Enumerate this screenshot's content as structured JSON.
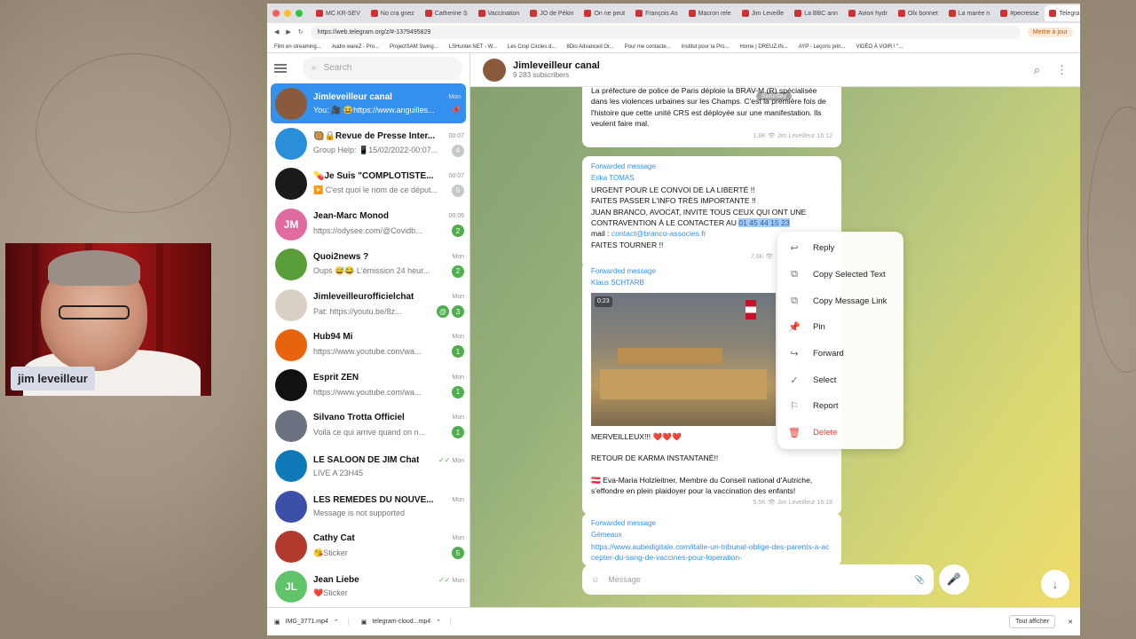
{
  "webcam": {
    "name": "jim leveilleur"
  },
  "browser": {
    "tabs": [
      "MC KR-SEV",
      "No cra gnez",
      "Catherine S",
      "Vaccination",
      "JO de Pékin",
      "On ne peut",
      "François As",
      "Macron rele",
      "Jim Leveille",
      "La BBC ann",
      "Avion hydr",
      "Olx bonnet",
      "La marée n",
      "#pecresse",
      "Telegram"
    ],
    "new_tab": "+",
    "close_tab": "×",
    "url": "https://web.telegram.org/z/#-1379495829",
    "update_button": "Mettre à jour",
    "bookmarks": [
      "Film en streaming...",
      "Audio wareZ - Pro...",
      "ProjectSAM Swing...",
      "LSHunter.NET - W...",
      "Les Crop Circles d...",
      "8Dio Advanced Or...",
      "Pour me contacte...",
      "Institut pour la Pro...",
      "Home | DREUZ.IN...",
      "AYP - Leçons prin...",
      "VIDÉO À VOIR ! \"..."
    ]
  },
  "sidebar": {
    "search_placeholder": "Search",
    "chats": [
      {
        "name": "Jimleveilleur canal",
        "time": "Mon",
        "preview": "You: 🎥 😆https://www.anguilles...",
        "avatar_color": "#8a5a3c",
        "initials": "",
        "badge": "",
        "pinned": "📌",
        "active": true
      },
      {
        "name": "🥘🔒Revue de Presse Inter...",
        "time": "00:07",
        "preview": "Group Help: 📱15/02/2022-00:07...",
        "avatar_color": "#2a8fd8",
        "initials": "",
        "badge": "4",
        "muted": true
      },
      {
        "name": "💊Je Suis \"COMPLOTISTE...",
        "time": "00:07",
        "preview": "▶️ C'est quoi le nom de ce déput...",
        "avatar_color": "#1a1a1a",
        "initials": "",
        "badge": "5",
        "muted": true
      },
      {
        "name": "Jean-Marc Monod",
        "time": "00:06",
        "preview": "https://odysee.com/@Covidb...",
        "avatar_color": "#e06ba0",
        "initials": "JM",
        "badge": "2"
      },
      {
        "name": "Quoi2news ?",
        "time": "Mon",
        "preview": "Oups 😅😂 L'émission 24 heur...",
        "avatar_color": "#5a9e3a",
        "initials": "",
        "badge": "2"
      },
      {
        "name": "Jimleveilleurofficielchat",
        "time": "Mon",
        "preview": "Pat: https://youtu.be/8z...",
        "avatar_color": "#d8d0c4",
        "initials": "",
        "badge": "3",
        "mention": "@"
      },
      {
        "name": "Hub94 Mi",
        "time": "Mon",
        "preview": "https://www.youtube.com/wa...",
        "avatar_color": "#e8640c",
        "initials": "",
        "badge": "1"
      },
      {
        "name": "Esprit ZEN",
        "time": "Mon",
        "preview": "https://www.youtube.com/wa...",
        "avatar_color": "#111111",
        "initials": "",
        "badge": "1"
      },
      {
        "name": "Silvano Trotta Officiel",
        "time": "Mon",
        "preview": "Voilà ce qui arrive quand on n...",
        "avatar_color": "#6b7280",
        "initials": "",
        "badge": "1"
      },
      {
        "name": "LE SALOON DE JIM Chat",
        "time": "Mon",
        "preview": "LIVE A 23H45",
        "avatar_color": "#0e7bb8",
        "initials": "",
        "badge": "",
        "read": "✓✓"
      },
      {
        "name": "LES REMÈDES DU NOUVE...",
        "time": "Mon",
        "preview": "Message is not supported",
        "avatar_color": "#3b4fa8",
        "initials": "",
        "badge": ""
      },
      {
        "name": "Cathy Cat",
        "time": "Mon",
        "preview": "😘Sticker",
        "avatar_color": "#b03a2e",
        "initials": "",
        "badge": "5"
      },
      {
        "name": "Jean Liebe",
        "time": "Mon",
        "preview": "❤️Sticker",
        "avatar_color": "#5fc46a",
        "initials": "JL",
        "badge": "",
        "read": "✓✓"
      }
    ]
  },
  "header": {
    "title": "Jimleveilleur canal",
    "subtitle": "9 283 subscribers"
  },
  "messages": [
    {
      "text": "La préfecture de police de Paris déploie la BRAV-M (R) spécialisée dans les violences urbaines sur les Champs. C'est la première fois de l'histoire que cette unité CRS est déployée sur une manifestation. Ils veulent faire mal.",
      "views": "1,8K",
      "author": "Jim Leveilleur",
      "time": "16:12",
      "date_chip": "Saturday"
    },
    {
      "fwd": "Forwarded message",
      "from": "Erika TOMAS",
      "lines": [
        "URGENT POUR LE CONVOI DE LA LIBERTÉ !!",
        "FAITES PASSER L'INFO TRÈS IMPORTANTE !!",
        "JUAN BRANCO, AVOCAT, INVITE TOUS CEUX QUI ONT UNE CONTRAVENTION À LE CONTACTER AU"
      ],
      "phone": "01 45 44 15 23",
      "mail_label": "mail : ",
      "mail": "contact@branco-associes.fr",
      "last": "FAITES TOURNER !!",
      "views": "7,6K"
    },
    {
      "fwd": "Forwarded message",
      "from": "Klaus SCHTARB",
      "video_time": "0:23",
      "lines": [
        "MERVEILLEUX!!! ❤️❤️❤️",
        "RETOUR DE KARMA INSTANTANÉ!!",
        "🇦🇹 Eva-Maria Holzleitner, Membre du Conseil national d'Autriche, s'effondre en plein plaidoyer pour la vaccination des enfants!"
      ],
      "views": "5,5K",
      "author": "Jim Leveilleur",
      "time": "16:18"
    },
    {
      "fwd": "Forwarded message",
      "from": "Gémeaux",
      "link": "https://www.aubedigitale.com/italie-un-tribunal-oblige-des-parents-a-accepter-du-sang-de-vaccines-pour-loperation-"
    }
  ],
  "context_menu": [
    {
      "label": "Reply",
      "icon": "reply-icon",
      "glyph": "↩"
    },
    {
      "label": "Copy Selected Text",
      "icon": "copy-icon",
      "glyph": "⧉"
    },
    {
      "label": "Copy Message Link",
      "icon": "copy-link-icon",
      "glyph": "⧉"
    },
    {
      "label": "Pin",
      "icon": "pin-icon",
      "glyph": "📌"
    },
    {
      "label": "Forward",
      "icon": "forward-icon",
      "glyph": "↪"
    },
    {
      "label": "Select",
      "icon": "check-circle-icon",
      "glyph": "✓"
    },
    {
      "label": "Report",
      "icon": "flag-icon",
      "glyph": "⚐"
    },
    {
      "label": "Delete",
      "icon": "trash-icon",
      "glyph": "🗑",
      "danger": true
    }
  ],
  "composer": {
    "placeholder": "Message"
  },
  "downloads": {
    "files": [
      "IMG_3771.mp4",
      "telegram-cloud...mp4"
    ],
    "show_all": "Tout afficher"
  }
}
